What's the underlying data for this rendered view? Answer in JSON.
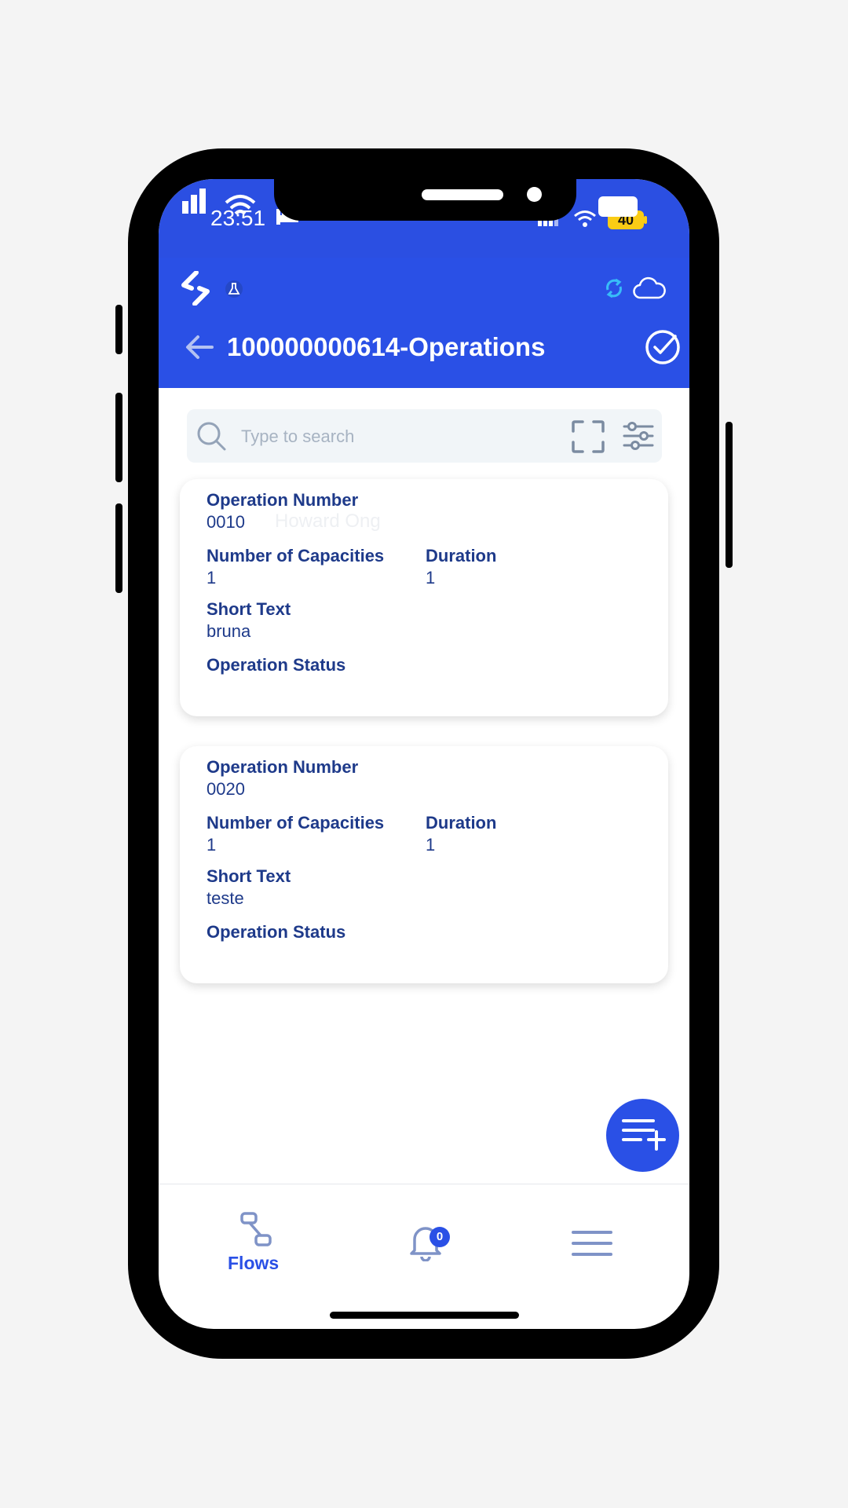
{
  "status_bar": {
    "time": "23:51",
    "battery": "40"
  },
  "header": {
    "title": "100000000614-Operations"
  },
  "search": {
    "placeholder": "Type to search"
  },
  "watermark": "Howard Ong",
  "operations": [
    {
      "operation_number_label": "Operation Number",
      "operation_number": "0010",
      "capacities_label": "Number of Capacities",
      "capacities": "1",
      "duration_label": "Duration",
      "duration": "1",
      "short_text_label": "Short Text",
      "short_text": "bruna",
      "status_label": "Operation Status"
    },
    {
      "operation_number_label": "Operation Number",
      "operation_number": "0020",
      "capacities_label": "Number of Capacities",
      "capacities": "1",
      "duration_label": "Duration",
      "duration": "1",
      "short_text_label": "Short Text",
      "short_text": "teste",
      "status_label": "Operation Status"
    }
  ],
  "bottom_nav": {
    "flows_label": "Flows",
    "notification_count": "0"
  },
  "colors": {
    "primary": "#2a50e6",
    "text_dark_blue": "#1e3a8a",
    "sync_icon": "#38bdf8"
  }
}
